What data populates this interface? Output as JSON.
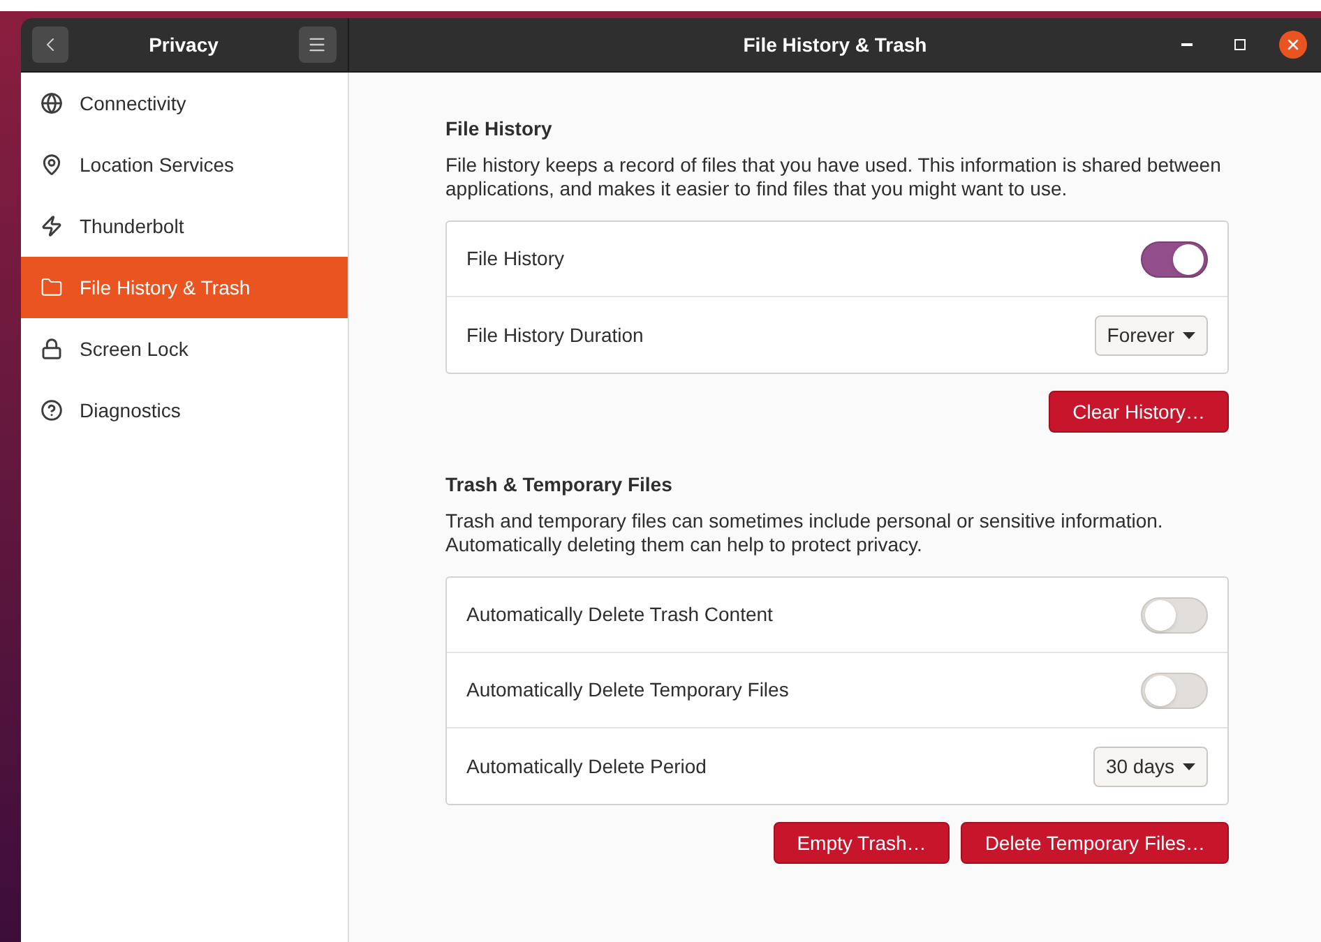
{
  "sidebar": {
    "title": "Privacy",
    "items": [
      {
        "label": "Connectivity",
        "kind": "globe",
        "selected": false
      },
      {
        "label": "Location Services",
        "kind": "pin",
        "selected": false
      },
      {
        "label": "Thunderbolt",
        "kind": "bolt",
        "selected": false
      },
      {
        "label": "File History & Trash",
        "kind": "folder",
        "selected": true
      },
      {
        "label": "Screen Lock",
        "kind": "lock",
        "selected": false
      },
      {
        "label": "Diagnostics",
        "kind": "help",
        "selected": false
      }
    ]
  },
  "window": {
    "title": "File History & Trash"
  },
  "sections": [
    {
      "title": "File History",
      "description": "File history keeps a record of files that you have used. This information is shared between applications, and makes it easier to find files that you might want to use.",
      "rows": [
        {
          "kind": "switch",
          "label": "File History",
          "on": true
        },
        {
          "kind": "dropdown",
          "label": "File History Duration",
          "value": "Forever"
        }
      ],
      "buttons": [
        "Clear History…"
      ]
    },
    {
      "title": "Trash & Temporary Files",
      "description": "Trash and temporary files can sometimes include personal or sensitive information. Automatically deleting them can help to protect privacy.",
      "rows": [
        {
          "kind": "switch",
          "label": "Automatically Delete Trash Content",
          "on": false
        },
        {
          "kind": "switch",
          "label": "Automatically Delete Temporary Files",
          "on": false
        },
        {
          "kind": "dropdown",
          "label": "Automatically Delete Period",
          "value": "30 days"
        }
      ],
      "buttons": [
        "Empty Trash…",
        "Delete Temporary Files…"
      ]
    }
  ]
}
